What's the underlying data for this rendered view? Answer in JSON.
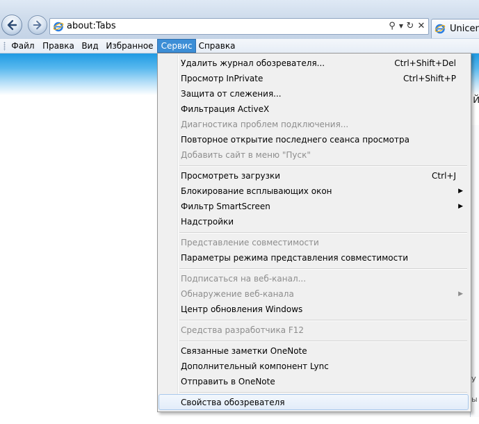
{
  "address_bar": {
    "url": "about:Tabs"
  },
  "tab": {
    "label": "Unicente"
  },
  "menubar": {
    "items": [
      "Файл",
      "Правка",
      "Вид",
      "Избранное",
      "Сервис",
      "Справка"
    ]
  },
  "tools_menu": {
    "items": [
      {
        "label": "Удалить журнал обозревателя...",
        "shortcut": "Ctrl+Shift+Del"
      },
      {
        "label": "Просмотр InPrivate",
        "shortcut": "Ctrl+Shift+P"
      },
      {
        "label": "Защита от слежения..."
      },
      {
        "label": "Фильтрация ActiveX"
      },
      {
        "label": "Диагностика проблем подключения..."
      },
      {
        "label": "Повторное открытие последнего сеанса просмотра"
      },
      {
        "label": "Добавить сайт в меню \"Пуск\""
      },
      {
        "label": "Просмотреть загрузки",
        "shortcut": "Ctrl+J"
      },
      {
        "label": "Блокирование всплывающих окон"
      },
      {
        "label": "Фильтр SmartScreen"
      },
      {
        "label": "Надстройки"
      },
      {
        "label": "Представление совместимости"
      },
      {
        "label": "Параметры режима представления совместимости"
      },
      {
        "label": "Подписаться на веб-канал..."
      },
      {
        "label": "Обнаружение веб-канала"
      },
      {
        "label": "Центр обновления Windows"
      },
      {
        "label": "Средства разработчика F12"
      },
      {
        "label": "Связанные заметки OneNote"
      },
      {
        "label": "Дополнительный компонент Lync"
      },
      {
        "label": "Отправить в OneNote"
      },
      {
        "label": "Свойства обозревателя"
      }
    ]
  },
  "page": {
    "glyph": "й",
    "frag1": "У",
    "frag2": "ы"
  }
}
